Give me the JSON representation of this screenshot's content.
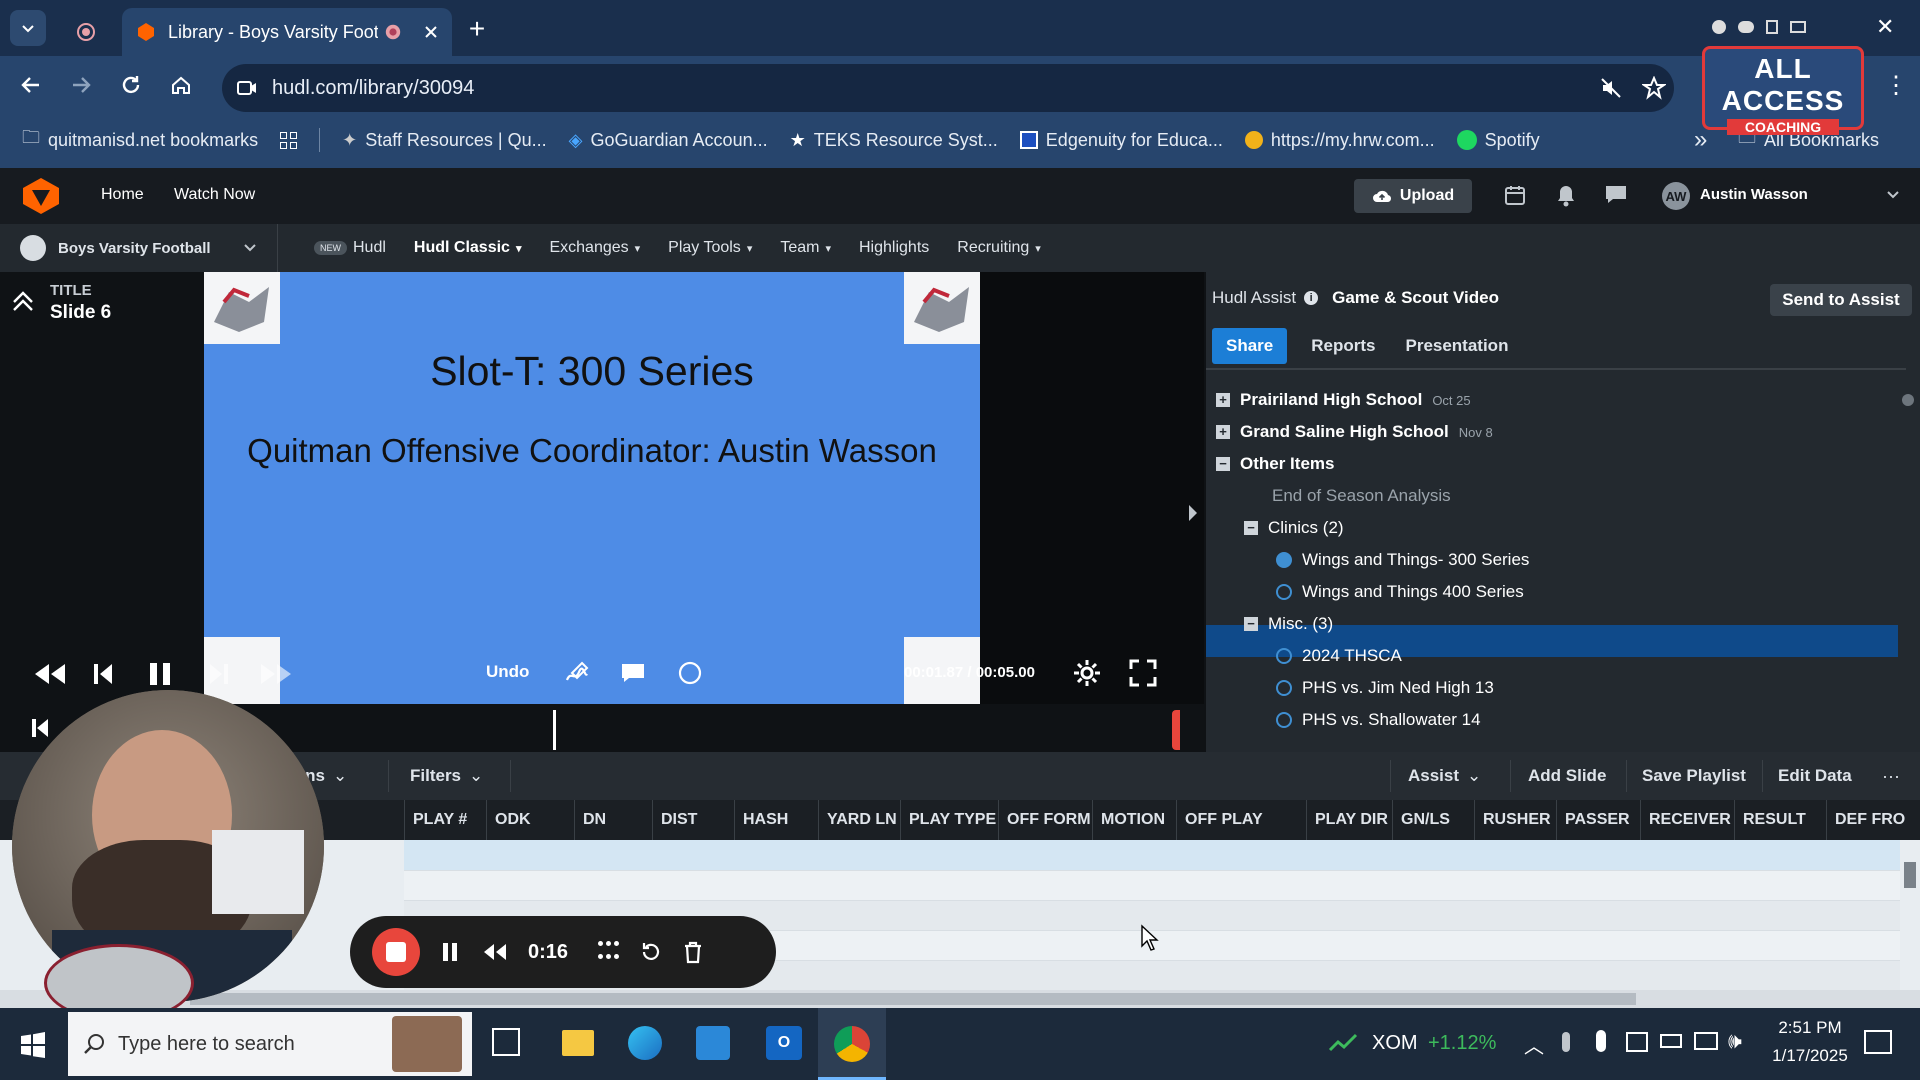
{
  "browser": {
    "tab_title": "Library - Boys Varsity Footb",
    "url": "hudl.com/library/30094",
    "bookmarks": [
      {
        "label": "quitmanisd.net bookmarks",
        "icon": "folder-icon"
      },
      {
        "label": "Staff Resources | Qu...",
        "icon": "bird-icon"
      },
      {
        "label": "GoGuardian Accoun...",
        "icon": "shield-icon"
      },
      {
        "label": "TEKS Resource Syst...",
        "icon": "star-icon"
      },
      {
        "label": "Edgenuity for Educa...",
        "icon": "edgenuity-icon"
      },
      {
        "label": "https://my.hrw.com...",
        "icon": "circle-icon"
      },
      {
        "label": "Spotify",
        "icon": "spotify-icon"
      }
    ],
    "all_bookmarks": "All Bookmarks",
    "overflow": "»"
  },
  "watermark": {
    "line1": "ALL ACCESS",
    "line2": "COACHING"
  },
  "hudl": {
    "nav": [
      "Home",
      "Watch Now"
    ],
    "upload": "Upload",
    "user_initials": "AW",
    "user_name": "Austin Wasson",
    "team": "Boys Varsity Football",
    "subnav": [
      {
        "label": "Hudl",
        "badge": "NEW",
        "caret": false
      },
      {
        "label": "Hudl Classic",
        "caret": true
      },
      {
        "label": "Exchanges",
        "caret": true
      },
      {
        "label": "Play Tools",
        "caret": true
      },
      {
        "label": "Team",
        "caret": true
      },
      {
        "label": "Highlights",
        "caret": false
      },
      {
        "label": "Recruiting",
        "caret": true
      }
    ]
  },
  "player": {
    "title_label": "TITLE",
    "title_value": "Slide 6",
    "slide_heading": "Slot-T: 300 Series",
    "slide_subheading": "Quitman Offensive Coordinator: Austin Wasson",
    "undo": "Undo",
    "time": "00:01.87 / 00:05.00"
  },
  "assist": {
    "label": "Hudl Assist",
    "section": "Game & Scout Video",
    "send": "Send to Assist",
    "tabs": [
      "Share",
      "Reports",
      "Presentation"
    ],
    "tree": [
      {
        "type": "plus",
        "label": "Prairiland High School",
        "date": "Oct 25",
        "indent": 0
      },
      {
        "type": "plus",
        "label": "Grand Saline High School",
        "date": "Nov 8",
        "indent": 0
      },
      {
        "type": "minus",
        "label": "Other Items",
        "date": "",
        "indent": 0
      },
      {
        "type": "none",
        "label": "End of Season Analysis",
        "date": "",
        "indent": 1
      },
      {
        "type": "minus",
        "label": "Clinics (2)",
        "date": "",
        "indent": 1
      },
      {
        "type": "radio-checked",
        "label": "Wings and Things- 300 Series",
        "date": "",
        "indent": 2
      },
      {
        "type": "radio",
        "label": "Wings and Things 400 Series",
        "date": "",
        "indent": 2
      },
      {
        "type": "minus",
        "label": "Misc. (3)",
        "date": "",
        "indent": 1
      },
      {
        "type": "radio",
        "label": "2024 THSCA",
        "date": "",
        "indent": 2
      },
      {
        "type": "radio",
        "label": "PHS vs. Jim Ned High 13",
        "date": "",
        "indent": 2
      },
      {
        "type": "radio",
        "label": "PHS vs. Shallowater 14",
        "date": "",
        "indent": 2
      }
    ]
  },
  "grid": {
    "columns_btn": "mns",
    "filters_btn": "Filters",
    "assist_btn": "Assist",
    "add_slide": "Add Slide",
    "save_playlist": "Save Playlist",
    "edit_data": "Edit Data",
    "more": "···",
    "headers": [
      "PLAY #",
      "ODK",
      "DN",
      "DIST",
      "HASH",
      "YARD LN",
      "PLAY TYPE",
      "OFF FORM",
      "MOTION",
      "OFF PLAY",
      "PLAY DIR",
      "GN/LS",
      "RUSHER",
      "PASSER",
      "RECEIVER",
      "RESULT",
      "DEF FRO"
    ]
  },
  "recorder": {
    "time": "0:16"
  },
  "taskbar": {
    "search_placeholder": "Type here to search",
    "stock_symbol": "XOM",
    "stock_change": "+1.12%",
    "time": "2:51 PM",
    "date": "1/17/2025"
  },
  "colors": {
    "accent": "#1c7ed6",
    "hudl_orange": "#ff6300",
    "record_red": "#e8463c",
    "slide_blue": "#4e8ce6"
  }
}
